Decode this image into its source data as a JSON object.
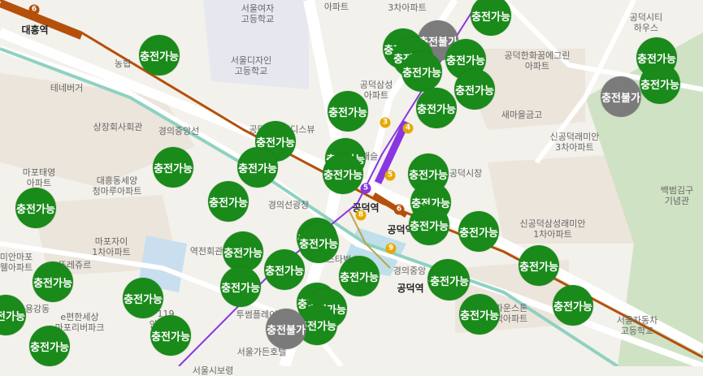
{
  "colors": {
    "available": "#1a8a1a",
    "unavailable": "#7b7b7b",
    "line6": "#b5500b",
    "line5": "#8936e0",
    "gyeongui": "#6fbfa8",
    "line9": "#bda64b",
    "park": "#cfe3c4",
    "road": "#ffffff",
    "block": "#e9e3da"
  },
  "stations": [
    {
      "name": "대흥역"
    },
    {
      "name": "공덕역"
    },
    {
      "name": "공덕역"
    },
    {
      "name": "공덕역"
    }
  ],
  "badges": [
    {
      "text": "6",
      "color": "#b5500b"
    },
    {
      "text": "3",
      "color": "#e8a800"
    },
    {
      "text": "4",
      "color": "#e8a800"
    },
    {
      "text": "5",
      "color": "#8936e0"
    },
    {
      "text": "5",
      "color": "#e8a800"
    },
    {
      "text": "6",
      "color": "#b5500b"
    },
    {
      "text": "8",
      "color": "#e8a800"
    },
    {
      "text": "9",
      "color": "#e8a800"
    }
  ],
  "labels": [
    "서울여자\n고등학교",
    "아파트",
    "3차아파트",
    "공덕시티\n하우스",
    "농협",
    "서울디자인\n고등학교",
    "공덕한화꿈에그린\n아파트",
    "테네버거",
    "공덕삼성\n아파트",
    "새마을금고",
    "상장회사회관",
    "공덕래미안디스뷰",
    "신공덕래미안\n3차아파트",
    "마포태영\n아파트",
    "대흥동세양\n청마루아파트",
    "롯데캐슬",
    "프공덕시장",
    "백범김구\n기념관",
    "경의선광장",
    "마포자이\n1차아파트",
    "신공덕삼성래미안\n1차아파트",
    "미안마포\n웰아파트",
    "뚜레쥬르",
    "역전회관",
    "스타벅스",
    "투썸플레이스",
    "브라운스톤\n공덕아파트",
    "서울자동차\n고등학교",
    "e편한세상\n마포리버파크",
    "119\n안전센터",
    "서울가든호텔",
    "경의중앙",
    "용강동",
    "서울시보령",
    "경의중앙선"
  ],
  "markers": [
    {
      "text": "충전가능",
      "type": "ok"
    },
    {
      "text": "충전가능",
      "type": "ok"
    },
    {
      "text": "충전불가",
      "type": "no"
    },
    {
      "text": "충전가능",
      "type": "ok"
    },
    {
      "text": "충전가능",
      "type": "ok"
    },
    {
      "text": "충전가능",
      "type": "ok"
    },
    {
      "text": "충전가능",
      "type": "ok"
    },
    {
      "text": "충전가능",
      "type": "ok"
    },
    {
      "text": "충전가능",
      "type": "ok"
    },
    {
      "text": "충전불가",
      "type": "no"
    },
    {
      "text": "충전가능",
      "type": "ok"
    },
    {
      "text": "충전가능",
      "type": "ok"
    },
    {
      "text": "충전가능",
      "type": "ok"
    },
    {
      "text": "충전가능",
      "type": "ok"
    },
    {
      "text": "충전가능",
      "type": "ok"
    },
    {
      "text": "충전가능",
      "type": "ok"
    },
    {
      "text": "충전가능",
      "type": "ok"
    },
    {
      "text": "충전가능",
      "type": "ok"
    },
    {
      "text": "충전가능",
      "type": "ok"
    },
    {
      "text": "충전가능",
      "type": "ok"
    },
    {
      "text": "충전가능",
      "type": "ok"
    },
    {
      "text": "충전가능",
      "type": "ok"
    },
    {
      "text": "충전가능",
      "type": "ok"
    },
    {
      "text": "충전가능",
      "type": "ok"
    },
    {
      "text": "충전가능",
      "type": "ok"
    },
    {
      "text": "충전가능",
      "type": "ok"
    },
    {
      "text": "충전가능",
      "type": "ok"
    },
    {
      "text": "충전가능",
      "type": "ok"
    },
    {
      "text": "충전가능",
      "type": "ok"
    },
    {
      "text": "충전가능",
      "type": "ok"
    },
    {
      "text": "충전가능",
      "type": "ok"
    },
    {
      "text": "충전가능",
      "type": "ok"
    },
    {
      "text": "충전가능",
      "type": "ok"
    },
    {
      "text": "충전가능",
      "type": "ok"
    },
    {
      "text": "충전가능",
      "type": "ok"
    },
    {
      "text": "충전가능",
      "type": "ok"
    },
    {
      "text": "충전가능",
      "type": "ok"
    },
    {
      "text": "충전가능",
      "type": "ok"
    },
    {
      "text": "충전가능",
      "type": "ok"
    },
    {
      "text": "충전가능",
      "type": "ok"
    },
    {
      "text": "충전불가",
      "type": "no"
    },
    {
      "text": "충전가능",
      "type": "ok"
    },
    {
      "text": "충전가능",
      "type": "ok"
    },
    {
      "text": "충전가능",
      "type": "ok"
    }
  ]
}
